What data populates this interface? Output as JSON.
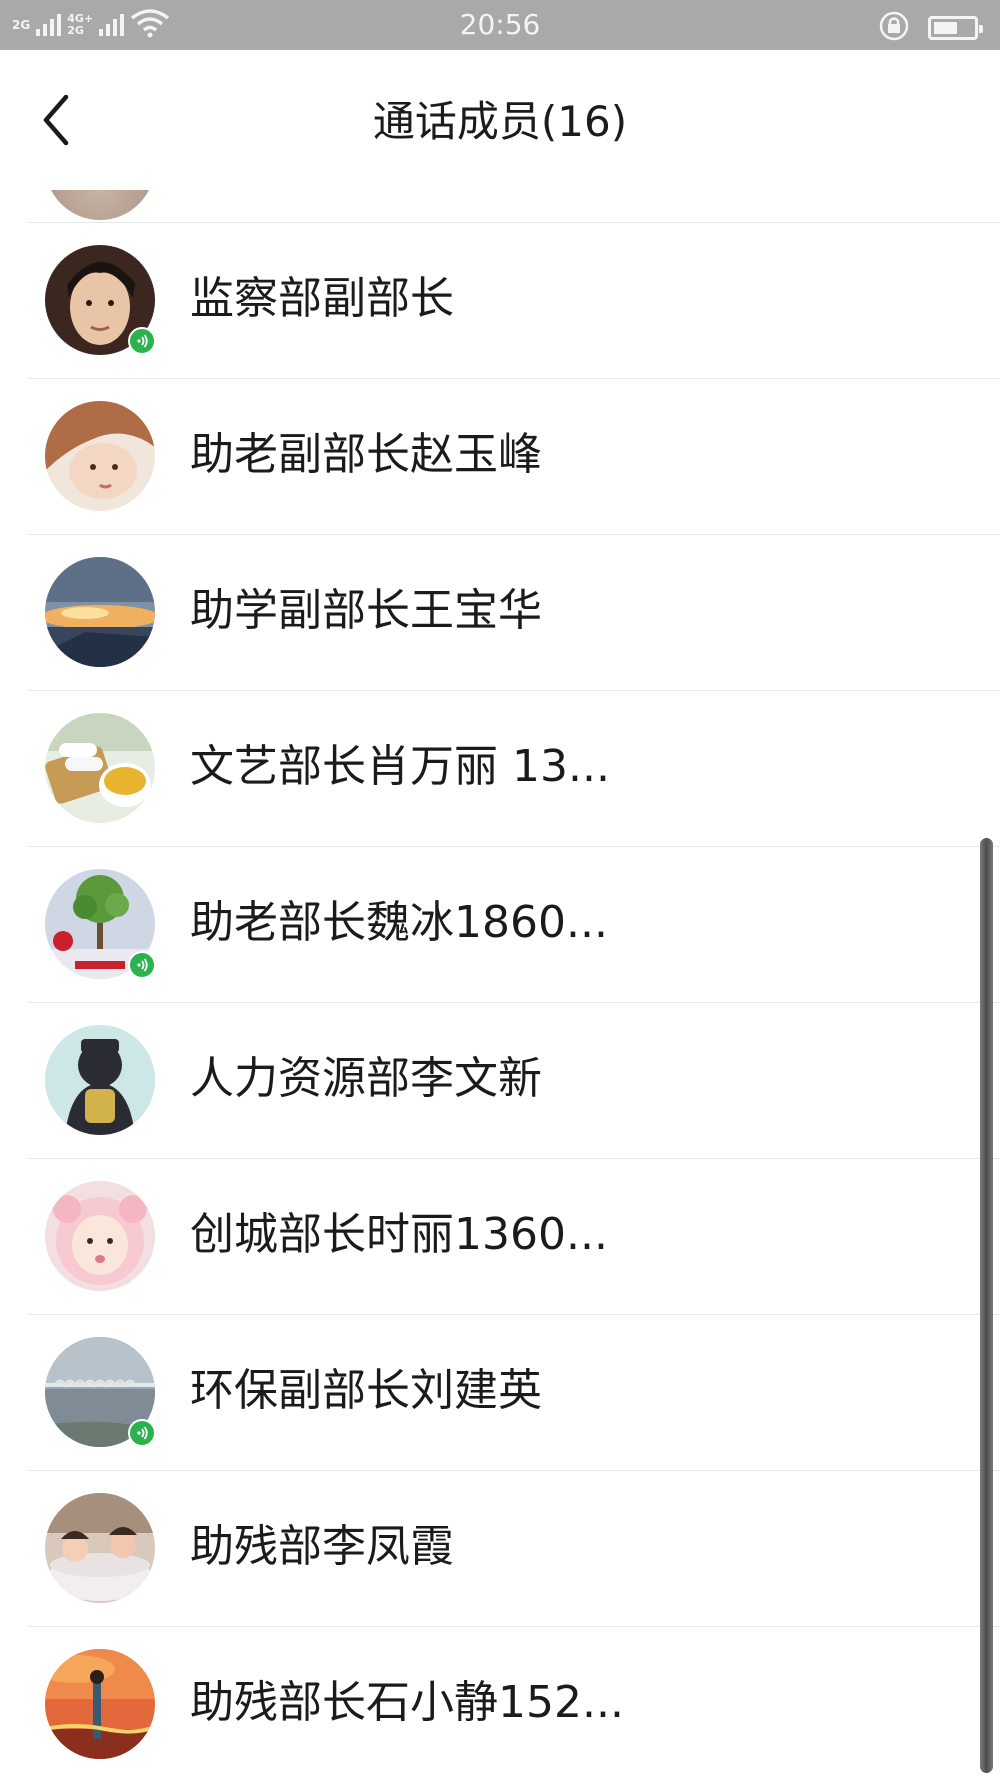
{
  "status_bar": {
    "sim1_label": "2G",
    "sim2_label_top": "4G+",
    "sim2_label_bottom": "2G",
    "time": "20:56",
    "battery_level": 0.6
  },
  "header": {
    "title": "通话成员(16)"
  },
  "members": [
    {
      "name": "监察部副部长",
      "speaking": true
    },
    {
      "name": "助老副部长赵玉峰",
      "speaking": false
    },
    {
      "name": "助学副部长王宝华",
      "speaking": false
    },
    {
      "name": "文艺部长肖万丽 13...",
      "speaking": false
    },
    {
      "name": "助老部长魏冰1860...",
      "speaking": true
    },
    {
      "name": "人力资源部李文新",
      "speaking": false
    },
    {
      "name": "创城部长时丽1360...",
      "speaking": false
    },
    {
      "name": "环保副部长刘建英",
      "speaking": true
    },
    {
      "name": "助残部李凤霞",
      "speaking": false
    },
    {
      "name": "助残部长石小静152...",
      "speaking": false
    }
  ],
  "colors": {
    "status_bar_bg": "#a9a9a9",
    "speaking_indicator": "#2bb24c",
    "divider": "#e8e8e8",
    "text": "#1b1b1b"
  },
  "icons": {
    "back": "chevron-left-icon",
    "wifi": "wifi-icon",
    "rotation_lock": "rotation-lock-icon",
    "battery": "battery-icon",
    "speaking": "speaking-sound-icon"
  }
}
